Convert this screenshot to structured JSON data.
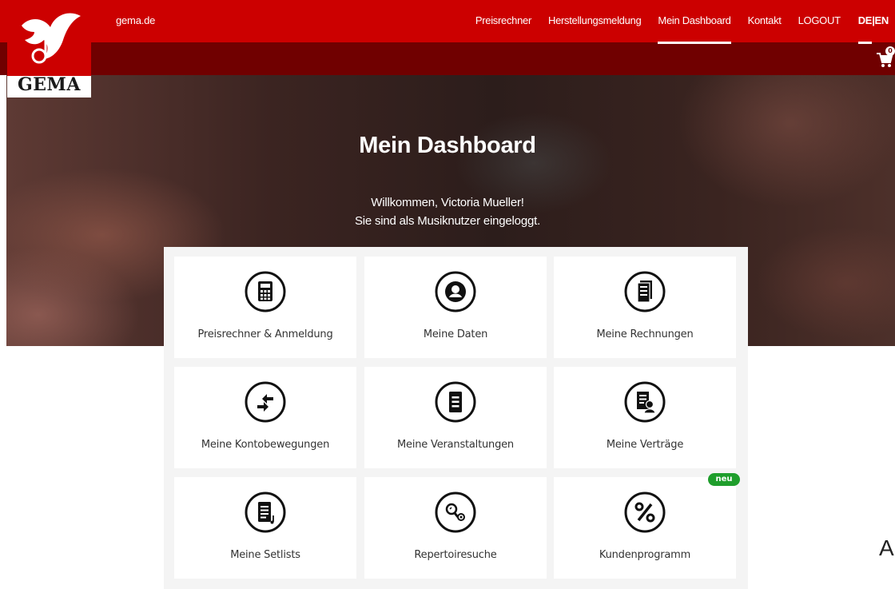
{
  "brand": {
    "logo_text": "GEMA",
    "site_link": "gema.de",
    "red": "#cc0000",
    "dark_red": "#700000"
  },
  "nav": {
    "items": [
      {
        "label": "Preisrechner",
        "name": "nav-preisrechner",
        "active": false
      },
      {
        "label": "Herstellungsmeldung",
        "name": "nav-herstellungsmeldung",
        "active": false
      },
      {
        "label": "Mein Dashboard",
        "name": "nav-mein-dashboard",
        "active": true
      },
      {
        "label": "Kontakt",
        "name": "nav-kontakt",
        "active": false
      },
      {
        "label": "LOGOUT",
        "name": "nav-logout",
        "active": false
      }
    ],
    "lang": {
      "de": "DE",
      "sep": "|",
      "en": "EN",
      "active": "DE"
    }
  },
  "cart": {
    "count": "0",
    "icon": "cart-icon"
  },
  "hero": {
    "title": "Mein Dashboard",
    "welcome": "Willkommen, Victoria Mueller!",
    "status": "Sie sind als Musiknutzer eingeloggt."
  },
  "tiles": [
    {
      "label": "Preisrechner & Anmeldung",
      "icon": "calculator-icon"
    },
    {
      "label": "Meine Daten",
      "icon": "user-icon"
    },
    {
      "label": "Meine Rechnungen",
      "icon": "invoice-icon"
    },
    {
      "label": "Meine Kontobewegungen",
      "icon": "transfer-arrows-icon"
    },
    {
      "label": "Meine Veranstaltungen",
      "icon": "document-list-icon"
    },
    {
      "label": "Meine Verträge",
      "icon": "contract-user-icon"
    },
    {
      "label": "Meine Setlists",
      "icon": "setlist-icon"
    },
    {
      "label": "Repertoiresuche",
      "icon": "search-music-icon"
    },
    {
      "label": "Kundenprogramm",
      "icon": "percent-icon"
    }
  ],
  "badge_new": "neu",
  "edge_letter": "A"
}
